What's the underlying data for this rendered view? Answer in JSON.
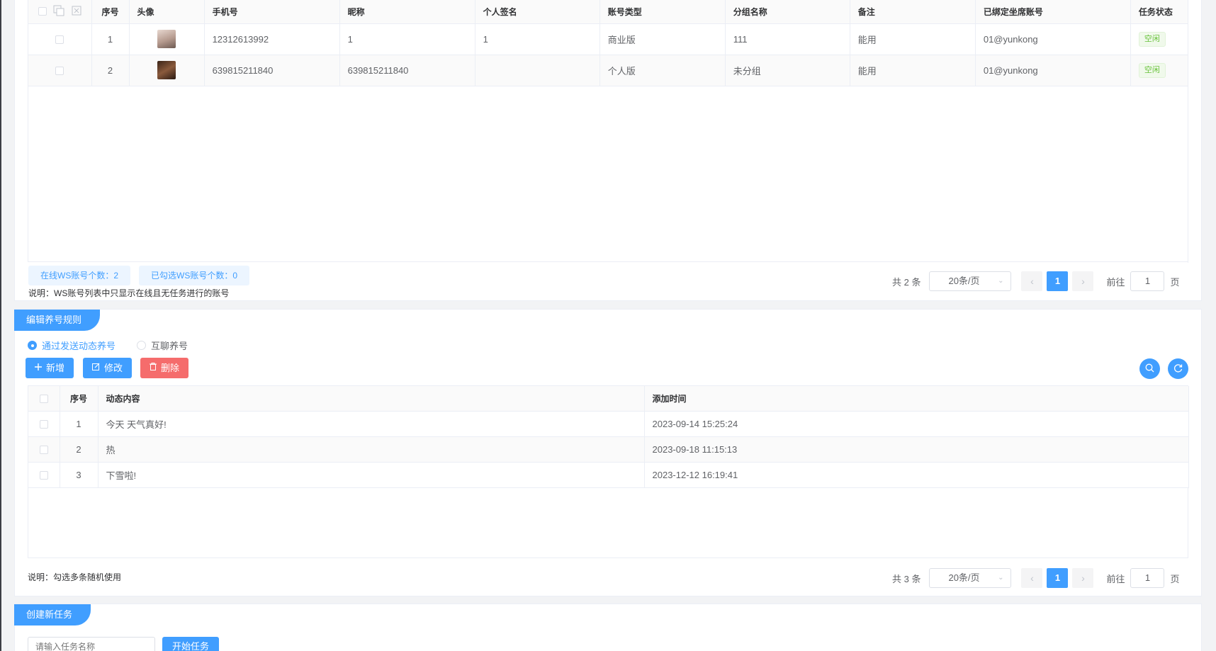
{
  "accounts_table": {
    "headers": [
      "序号",
      "头像",
      "手机号",
      "昵称",
      "个人签名",
      "账号类型",
      "分组名称",
      "备注",
      "已绑定坐席账号",
      "任务状态"
    ],
    "rows": [
      {
        "index": "1",
        "phone": "12312613992",
        "nickname": "1",
        "signature": "1",
        "type": "商业版",
        "group": "111",
        "remark": "能用",
        "seat": "01@yunkong",
        "status": "空闲"
      },
      {
        "index": "2",
        "phone": "639815211840",
        "nickname": "639815211840",
        "signature": "",
        "type": "个人版",
        "group": "未分组",
        "remark": "能用",
        "seat": "01@yunkong",
        "status": "空闲"
      }
    ],
    "online_badge": "在线WS账号个数：2",
    "selected_badge": "已勾选WS账号个数：0",
    "note": "说明：WS账号列表中只显示在线且无任务进行的账号",
    "pager": {
      "total": "共 2 条",
      "page_size": "20条/页",
      "current": "1",
      "goto_label": "前往",
      "goto_value": "1",
      "page_suffix": "页"
    }
  },
  "rules_panel": {
    "title": "编辑养号规则",
    "radio_options": [
      "通过发送动态养号",
      "互聊养号"
    ],
    "selected_radio": "通过发送动态养号",
    "buttons": {
      "add": "新增",
      "edit": "修改",
      "delete": "删除"
    },
    "icons": {
      "add": "plus-icon",
      "edit": "edit-icon",
      "delete": "trash-icon",
      "search": "search-icon",
      "refresh": "refresh-icon"
    },
    "table": {
      "headers": [
        "序号",
        "动态内容",
        "添加时间"
      ],
      "rows": [
        {
          "index": "1",
          "content": "今天 天气真好!",
          "time": "2023-09-14 15:25:24"
        },
        {
          "index": "2",
          "content": "热",
          "time": "2023-09-18 11:15:13"
        },
        {
          "index": "3",
          "content": "下雪啦!",
          "time": "2023-12-12 16:19:41"
        }
      ]
    },
    "note": "说明：勾选多条随机使用",
    "pager": {
      "total": "共 3 条",
      "page_size": "20条/页",
      "current": "1",
      "goto_label": "前往",
      "goto_value": "1",
      "page_suffix": "页"
    }
  },
  "task_panel": {
    "title": "创建新任务",
    "input_placeholder": "请输入任务名称",
    "start_button": "开始任务"
  },
  "colors": {
    "primary": "#409eff",
    "danger": "#f56c6c",
    "success": "#67c23a"
  }
}
